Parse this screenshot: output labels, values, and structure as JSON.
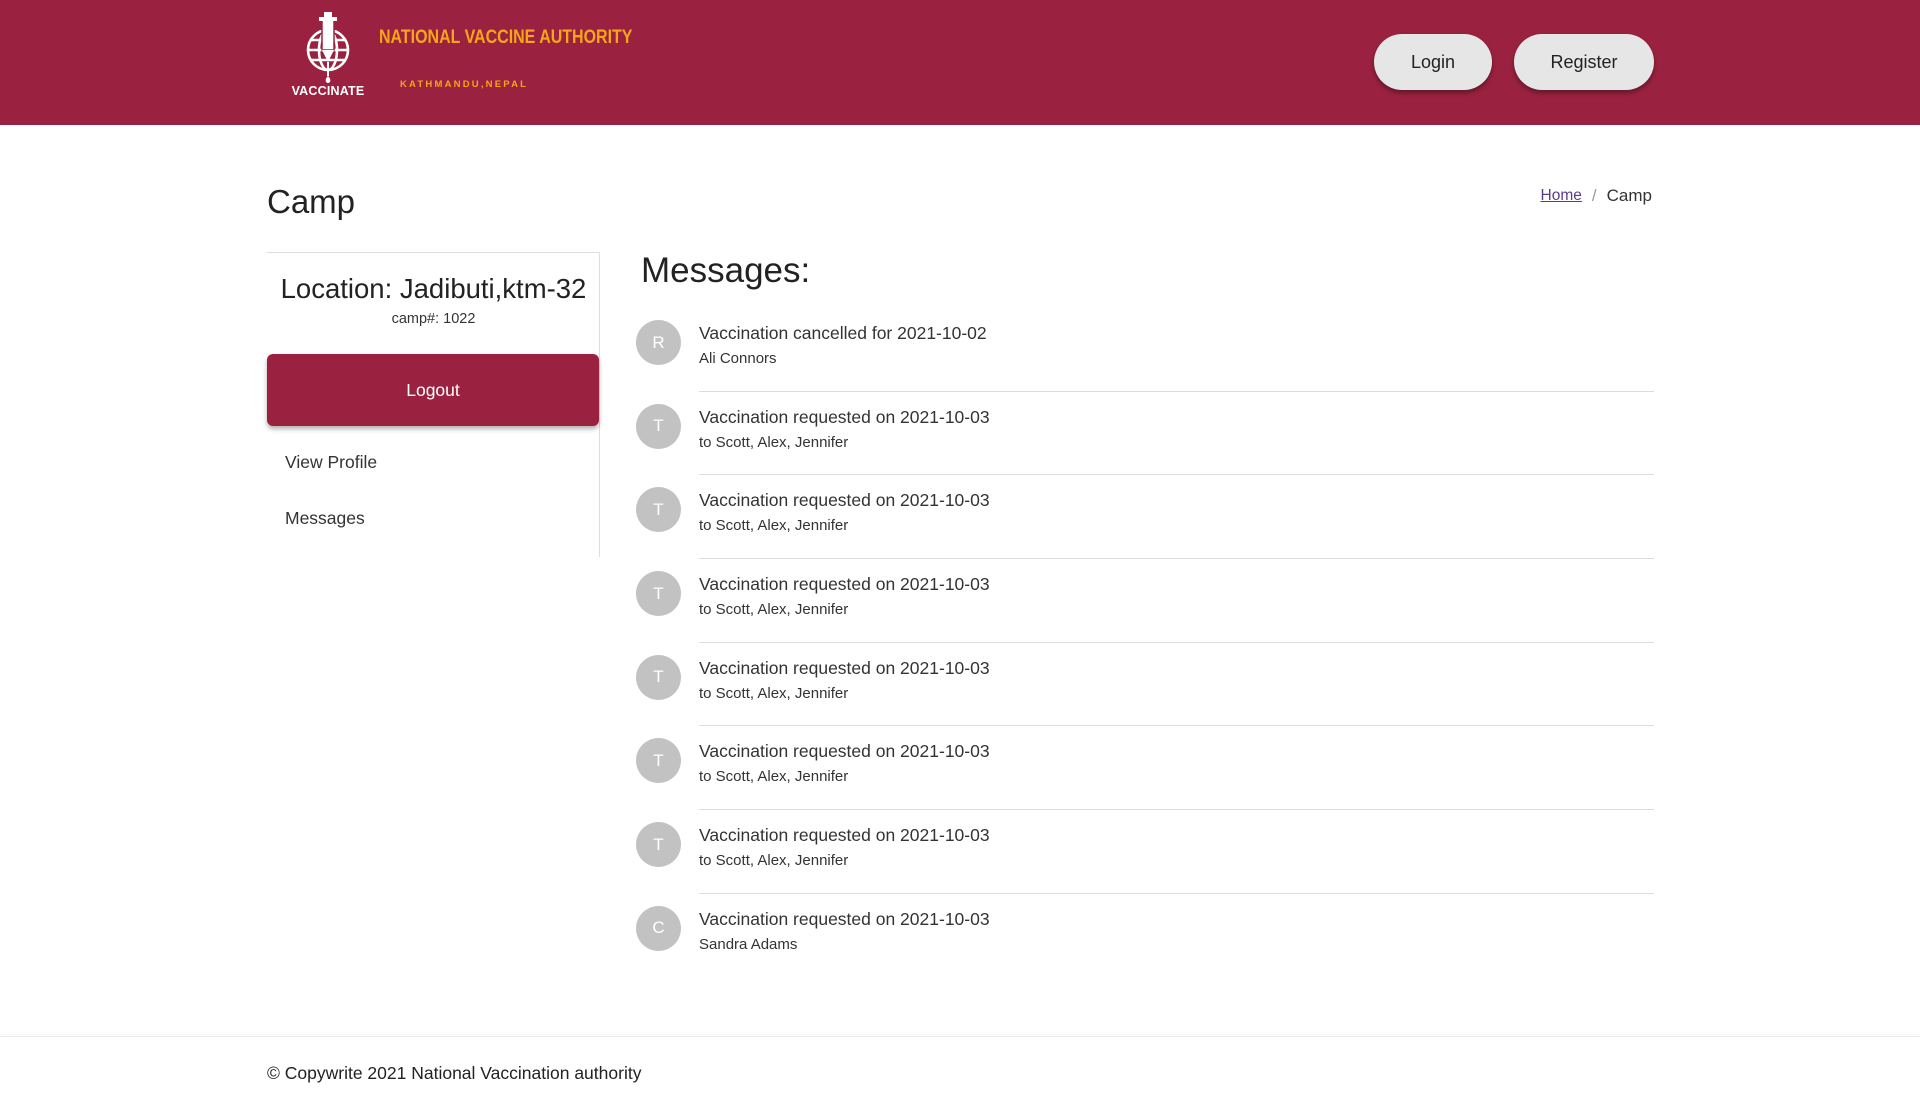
{
  "header": {
    "logo_word": "VACCINATE",
    "brand_title": "NATIONAL VACCINE AUTHORITY",
    "brand_subtitle": "KATHMANDU,NEPAL",
    "login_label": "Login",
    "register_label": "Register",
    "colors": {
      "header_bg": "#9a2240",
      "brand_text": "#f6a519"
    }
  },
  "page": {
    "title": "Camp",
    "breadcrumb": {
      "home": "Home",
      "separator": "/",
      "current": "Camp"
    }
  },
  "sidebar": {
    "location": "Location: Jadibuti,ktm-32",
    "camp_number": "camp#: 1022",
    "logout_label": "Logout",
    "links": {
      "view_profile": "View Profile",
      "messages": "Messages"
    }
  },
  "messages": {
    "heading": "Messages:",
    "items": [
      {
        "initial": "R",
        "title": "Vaccination cancelled for 2021-10-02",
        "subtitle": "Ali Connors"
      },
      {
        "initial": "T",
        "title": "Vaccination requested on 2021-10-03",
        "subtitle": "to Scott, Alex, Jennifer"
      },
      {
        "initial": "T",
        "title": "Vaccination requested on 2021-10-03",
        "subtitle": "to Scott, Alex, Jennifer"
      },
      {
        "initial": "T",
        "title": "Vaccination requested on 2021-10-03",
        "subtitle": "to Scott, Alex, Jennifer"
      },
      {
        "initial": "T",
        "title": "Vaccination requested on 2021-10-03",
        "subtitle": "to Scott, Alex, Jennifer"
      },
      {
        "initial": "T",
        "title": "Vaccination requested on 2021-10-03",
        "subtitle": "to Scott, Alex, Jennifer"
      },
      {
        "initial": "T",
        "title": "Vaccination requested on 2021-10-03",
        "subtitle": "to Scott, Alex, Jennifer"
      },
      {
        "initial": "C",
        "title": "Vaccination requested on 2021-10-03",
        "subtitle": "Sandra Adams"
      }
    ]
  },
  "footer": {
    "text": "© Copywrite 2021 National Vaccination authority"
  }
}
